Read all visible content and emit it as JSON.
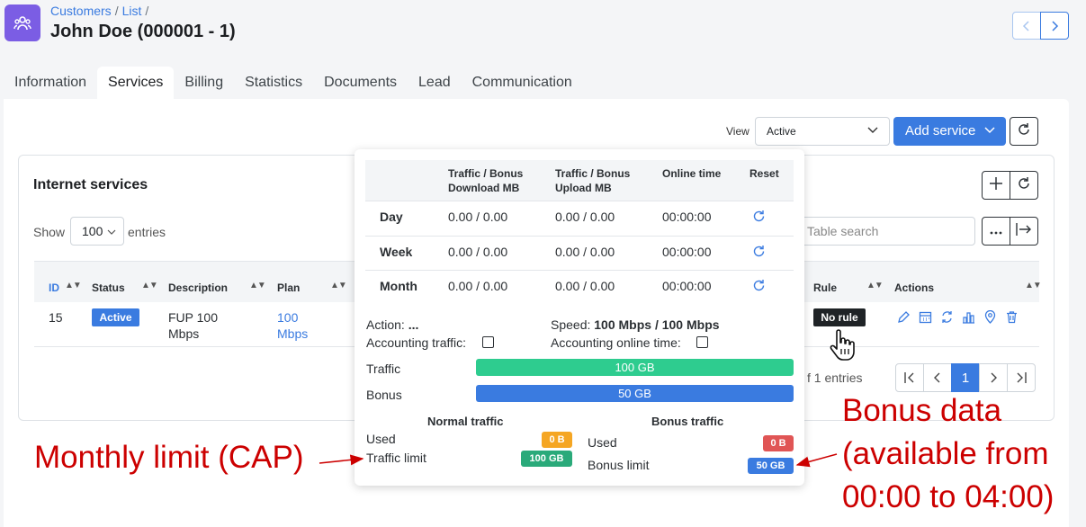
{
  "header": {
    "breadcrumb": [
      "Customers",
      "List"
    ],
    "breadcrumb_sep": "/",
    "title": "John Doe (000001 - 1)"
  },
  "tabs": [
    "Information",
    "Services",
    "Billing",
    "Statistics",
    "Documents",
    "Lead",
    "Communication"
  ],
  "active_tab": "Services",
  "toolbar": {
    "view_label": "View",
    "view_value": "Active",
    "add_service_label": "Add service"
  },
  "internet_services": {
    "title": "Internet services",
    "show_label": "Show",
    "show_value": "100",
    "entries_label": "entries",
    "search_placeholder": "Table search",
    "columns": {
      "id": "ID",
      "status": "Status",
      "description": "Description",
      "plan": "Plan",
      "rule": "Rule",
      "actions": "Actions"
    },
    "row": {
      "id": "15",
      "status": "Active",
      "description_1": "FUP 100",
      "description_2": "Mbps",
      "plan_1": "100",
      "plan_2": "Mbps",
      "rule": "No rule"
    },
    "entries_info": "f 1 entries",
    "pager": {
      "current": "1"
    }
  },
  "popover": {
    "columns": {
      "download_1": "Traffic / Bonus",
      "download_2": "Download MB",
      "upload_1": "Traffic / Bonus",
      "upload_2": "Upload MB",
      "online": "Online time",
      "reset": "Reset"
    },
    "rows": [
      {
        "label": "Day",
        "download": "0.00 / 0.00",
        "upload": "0.00 / 0.00",
        "online": "00:00:00"
      },
      {
        "label": "Week",
        "download": "0.00 / 0.00",
        "upload": "0.00 / 0.00",
        "online": "00:00:00"
      },
      {
        "label": "Month",
        "download": "0.00 / 0.00",
        "upload": "0.00 / 0.00",
        "online": "00:00:00"
      }
    ],
    "action_label": "Action:",
    "action_value": "...",
    "speed_label": "Speed:",
    "speed_value": "100 Mbps / 100 Mbps",
    "accounting_traffic": "Accounting traffic:",
    "accounting_online_time": "Accounting online time:",
    "traffic_label": "Traffic",
    "traffic_value": "100 GB",
    "bonus_label": "Bonus",
    "bonus_value": "50 GB",
    "normal_title": "Normal traffic",
    "bonus_title": "Bonus traffic",
    "used_label": "Used",
    "normal_used": "0 B",
    "traffic_limit_label": "Traffic limit",
    "traffic_limit": "100 GB",
    "bonus_used": "0 B",
    "bonus_limit_label": "Bonus limit",
    "bonus_limit": "50 GB"
  },
  "annotations": {
    "monthly": "Monthly limit (CAP)",
    "bonus_1": "Bonus data",
    "bonus_2": "(available from",
    "bonus_3": "00:00 to 04:00)"
  },
  "colors": {
    "accent": "#3a7be0",
    "app_icon": "#7b5de4",
    "traffic_bar": "#2ecc8f",
    "bonus_bar": "#3a7be0",
    "used_normal": "#f5a623",
    "used_bonus": "#e05555",
    "annotation": "#cc0000"
  },
  "icons": [
    "team-icon",
    "chevron-left-icon",
    "chevron-right-icon",
    "chevron-down-icon",
    "refresh-icon",
    "plus-icon",
    "more-icon",
    "export-icon",
    "edit-icon",
    "calendar-icon",
    "swap-icon",
    "stats-icon",
    "location-icon",
    "trash-icon",
    "reset-icon",
    "hand-cursor-icon"
  ]
}
